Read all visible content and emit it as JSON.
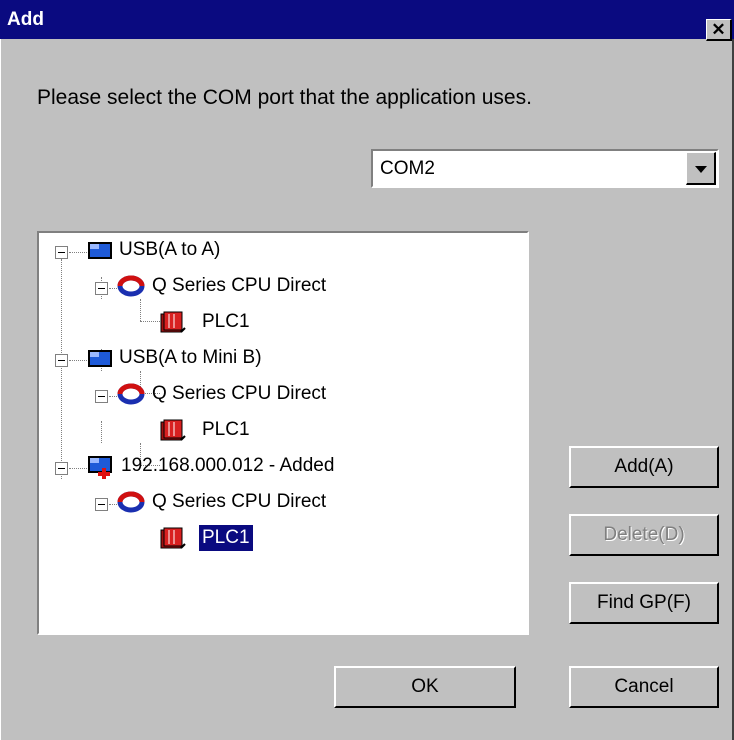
{
  "window": {
    "title": "Add"
  },
  "prompt": "Please select the COM port that the application uses.",
  "com_port": {
    "selected": "COM2"
  },
  "tree": {
    "nodes": [
      {
        "label": "USB(A to A)",
        "icon": "usb-cable-icon"
      },
      {
        "label": "Q Series CPU Direct",
        "icon": "connection-icon"
      },
      {
        "label": "PLC1",
        "icon": "plc-icon"
      },
      {
        "label": "USB(A to Mini B)",
        "icon": "usb-cable-icon"
      },
      {
        "label": "Q Series CPU Direct",
        "icon": "connection-icon"
      },
      {
        "label": "PLC1",
        "icon": "plc-icon"
      },
      {
        "label": "192.168.000.012 - Added",
        "icon": "network-added-icon"
      },
      {
        "label": "Q Series CPU Direct",
        "icon": "connection-icon"
      },
      {
        "label": "PLC1",
        "icon": "plc-icon",
        "selected": true
      }
    ]
  },
  "buttons": {
    "add": "Add(A)",
    "delete": "Delete(D)",
    "find_gp": "Find GP(F)",
    "ok": "OK",
    "cancel": "Cancel"
  }
}
